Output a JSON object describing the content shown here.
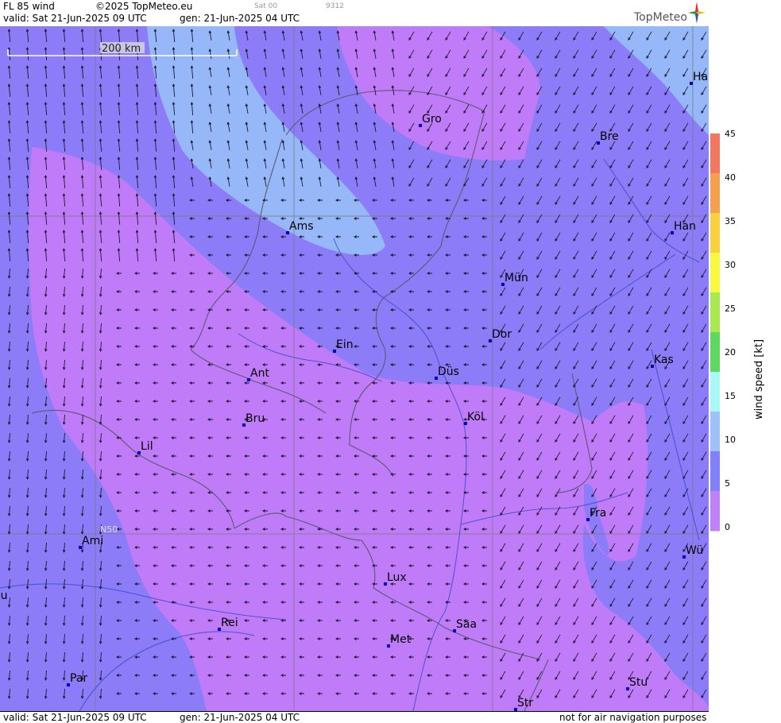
{
  "header": {
    "product": "FL 85 wind",
    "copyright": "©2025 TopMeteo.eu",
    "sat_label": "Sat 00",
    "code": "9312",
    "valid": "valid:  Sat  21-Jun-2025  09 UTC",
    "gen": "gen: 21-Jun-2025 04 UTC",
    "logo": "TopMeteo"
  },
  "footer": {
    "valid": "valid:  Sat  21-Jun-2025  09 UTC",
    "gen": "gen: 21-Jun-2025 04 UTC",
    "disclaimer": "not for air navigation purposes"
  },
  "map": {
    "scale_label": "200 km",
    "lat_label": "N50",
    "cities": [
      "Ha",
      "Gro",
      "Bre",
      "Ams",
      "Han",
      "Mün",
      "Ein",
      "Dor",
      "Ant",
      "Düs",
      "Kas",
      "Bru",
      "Köl",
      "Lil",
      "Fra",
      "Ami",
      "Wü",
      "ou",
      "Lux",
      "Rei",
      "Saa",
      "Met",
      "Par",
      "Stu",
      "Str"
    ]
  },
  "legend": {
    "title": "wind  speed  [kt]",
    "ticks": [
      "45",
      "40",
      "35",
      "30",
      "25",
      "20",
      "15",
      "10",
      "5",
      "0"
    ],
    "colors": [
      "#f07860",
      "#f4a050",
      "#f8d040",
      "#f8f840",
      "#a8e850",
      "#60d860",
      "#a8f8f8",
      "#a0c0f8",
      "#8080f8",
      "#c080f8"
    ]
  }
}
